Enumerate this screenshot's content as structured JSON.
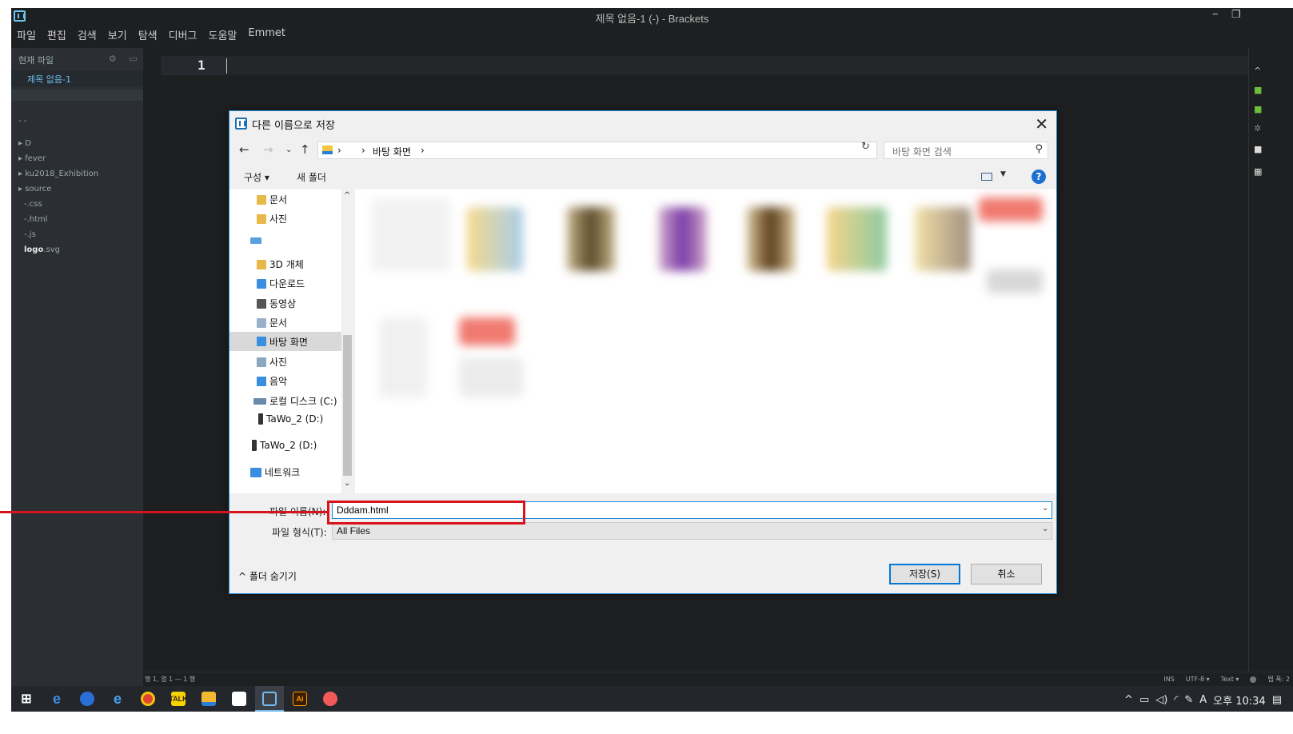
{
  "app": {
    "title": "제목 없음-1 (-) - Brackets",
    "menu": [
      "파일",
      "편집",
      "검색",
      "보기",
      "탐색",
      "디버그",
      "도움말",
      "Emmet"
    ]
  },
  "sidebar": {
    "header": "현재 파일",
    "open_file": "제목 없음-1",
    "folder_dots": "- -",
    "tree": [
      {
        "label": "D",
        "type": "folder"
      },
      {
        "label": "fever",
        "type": "folder"
      },
      {
        "label": "ku2018_Exhibition",
        "type": "folder"
      },
      {
        "label": "source",
        "type": "folder"
      },
      {
        "label": "-.css",
        "type": "file"
      },
      {
        "label": "-.html",
        "type": "file"
      },
      {
        "label": "-.js",
        "type": "file"
      }
    ],
    "logo_file": {
      "name": "logo",
      "ext": ".svg"
    }
  },
  "editor": {
    "line_number": "1"
  },
  "statusbar": {
    "position": "행 1, 열 1 — 1 행",
    "mode": "INS",
    "encoding": "UTF-8 ▾",
    "language": "Text ▾",
    "indent": "탭 폭: 2"
  },
  "dialog": {
    "title": "다른 이름으로 저장",
    "breadcrumb": [
      "›",
      "›",
      "바탕 화면",
      "›"
    ],
    "search_placeholder": "바탕 화면 검색",
    "toolbar": {
      "organize": "구성 ▾",
      "new_folder": "새 폴더"
    },
    "nav_items": [
      {
        "label": "문서",
        "color": "#e8b84a"
      },
      {
        "label": "사진",
        "color": "#e8b84a"
      },
      {
        "label": "",
        "color": "#5aa0e0"
      },
      {
        "label": "3D 개체",
        "color": "#e8b84a"
      },
      {
        "label": "다운로드",
        "color": "#3a8ee0"
      },
      {
        "label": "동영상",
        "color": "#555555"
      },
      {
        "label": "문서",
        "color": "#9ab0c8"
      },
      {
        "label": "바탕 화면",
        "color": "#3a8ee0",
        "selected": true
      },
      {
        "label": "사진",
        "color": "#8aa8c0"
      },
      {
        "label": "음악",
        "color": "#3a8ee0"
      },
      {
        "label": "로컬 디스크 (C:)",
        "color": "#6a8aaa"
      },
      {
        "label": "TaWo_2 (D:)",
        "color": "#333333"
      },
      {
        "label": "TaWo_2 (D:)",
        "color": "#333333"
      },
      {
        "label": "네트워크",
        "color": "#3a8ee0"
      }
    ],
    "file_name_label": "파일 이름(N):",
    "file_name_value": "Dddam.html",
    "file_type_label": "파일 형식(T):",
    "file_type_value": "All Files",
    "hide_folders": "^ 폴더 숨기기",
    "save_button": "저장(S)",
    "cancel_button": "취소"
  },
  "taskbar": {
    "apps": [
      "start",
      "edge",
      "firefox",
      "ie",
      "chrome",
      "kakaotalk",
      "explorer",
      "notes",
      "brackets",
      "illustrator",
      "paint"
    ],
    "time": "오후 10:34",
    "ime": "A"
  },
  "colors": {
    "accent": "#1f8ad2",
    "annotation": "#d7141c",
    "editor_bg": "#1d1f21",
    "sidebar_bg": "#2b2f33"
  }
}
